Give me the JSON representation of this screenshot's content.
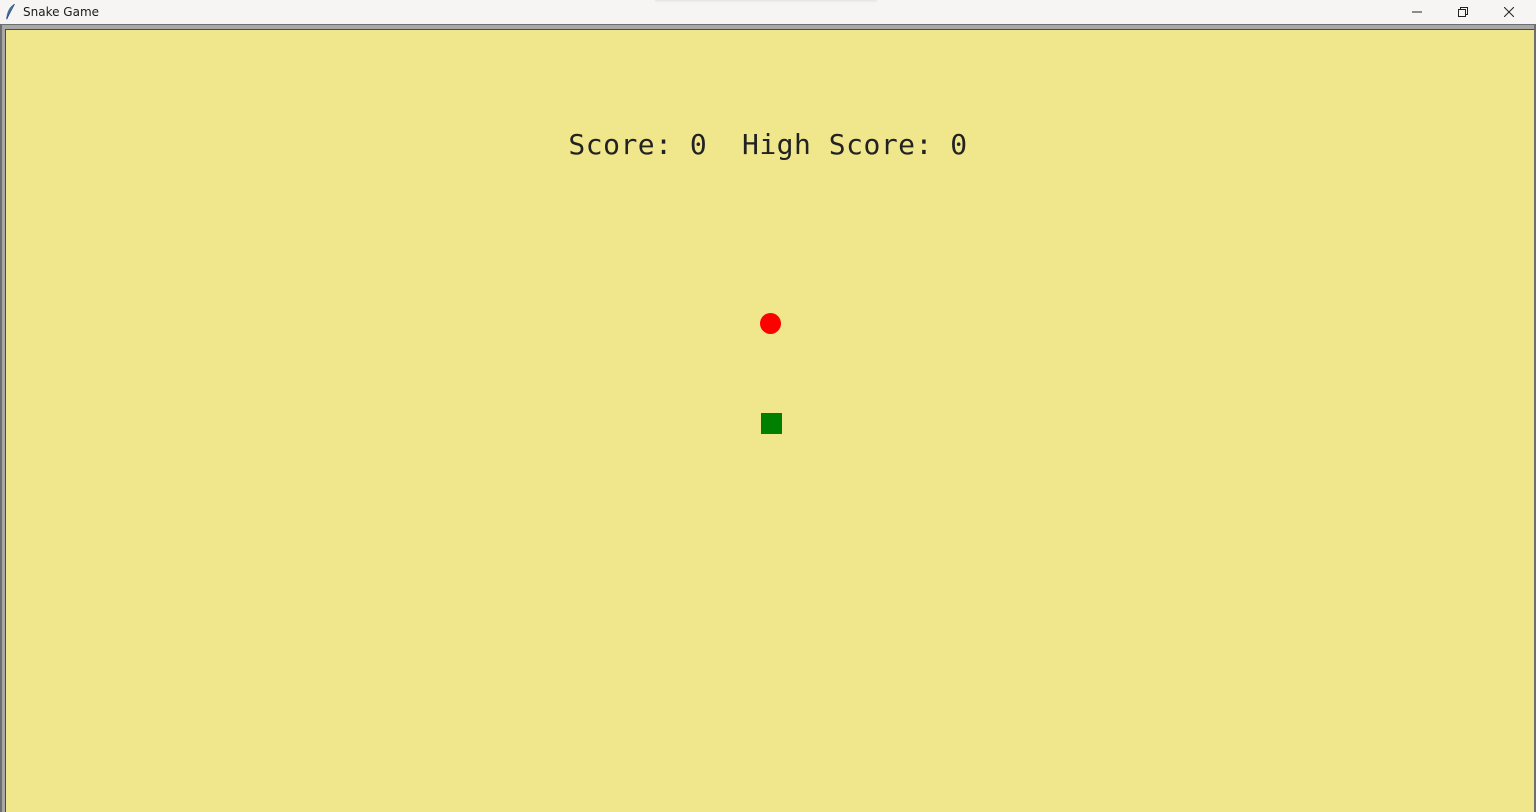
{
  "window": {
    "title": "Snake Game",
    "icon": "feather-icon"
  },
  "scoreboard": {
    "score_label": "Score:",
    "score": 0,
    "high_score_label": "High Score:",
    "high_score": 0
  },
  "game": {
    "background_color": "#f0e68c",
    "food": {
      "shape": "circle",
      "color": "#ff0000"
    },
    "snake": {
      "segments": 1,
      "color": "#008000"
    }
  }
}
